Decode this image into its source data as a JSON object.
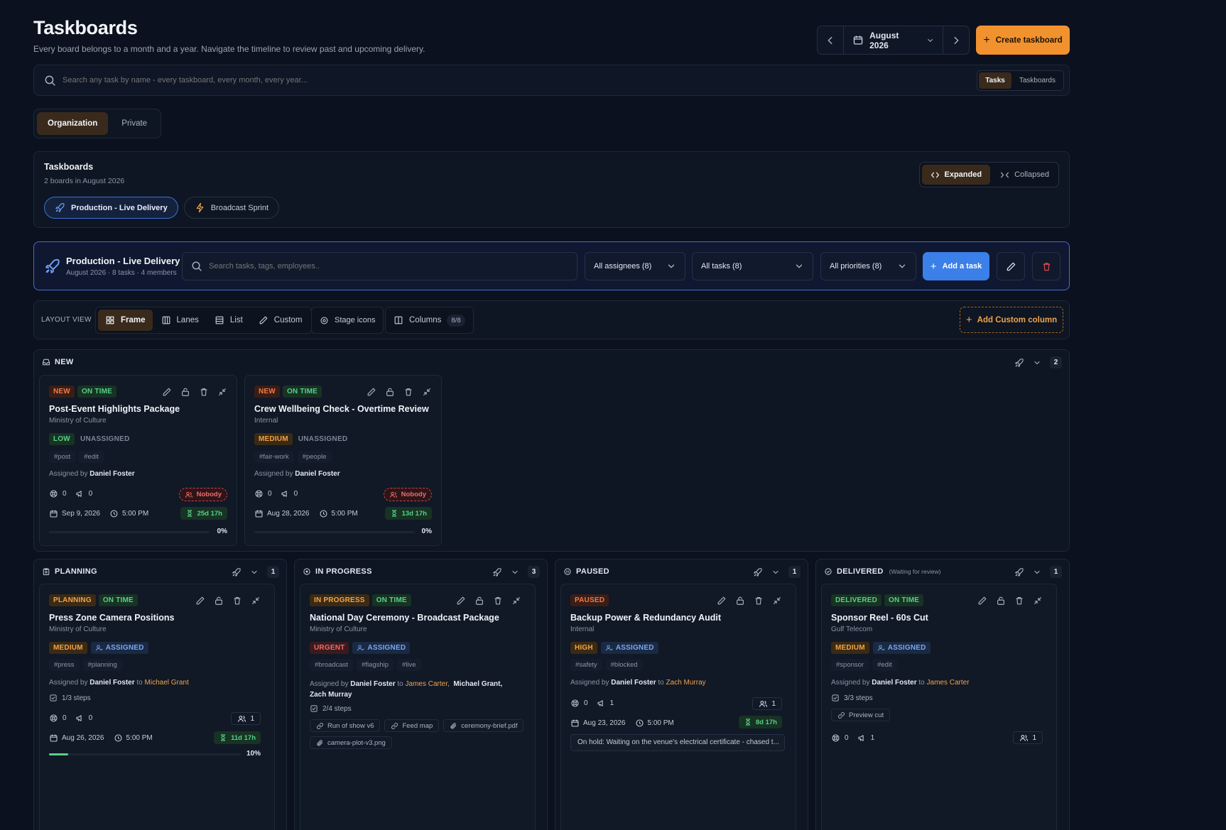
{
  "header": {
    "title": "Taskboards",
    "subtitle": "Every board belongs to a month and a year. Navigate the timeline to review past and upcoming delivery.",
    "month": "August 2026",
    "create_label": "Create taskboard"
  },
  "global_search": {
    "placeholder": "Search any task by name - every taskboard, every month, every year...",
    "tabs": [
      "Tasks",
      "Taskboards"
    ]
  },
  "scope_tabs": [
    "Organization",
    "Private"
  ],
  "boards_panel": {
    "title": "Taskboards",
    "subtitle": "2 boards in August 2026",
    "view_expanded": "Expanded",
    "view_collapsed": "Collapsed",
    "boards": [
      "Production - Live Delivery",
      "Broadcast Sprint"
    ]
  },
  "board": {
    "name": "Production - Live Delivery",
    "meta": "August 2026 · 8 tasks · 4 members",
    "search_placeholder": "Search tasks, tags, employees..",
    "filter_assignees": "All assignees (8)",
    "filter_tasks": "All tasks (8)",
    "filter_priorities": "All priorities (8)",
    "add_task": "Add a task"
  },
  "layout": {
    "label": "LAYOUT VIEW",
    "views": [
      "Frame",
      "Lanes",
      "List",
      "Custom"
    ],
    "stage_icons": "Stage icons",
    "columns": "Columns",
    "columns_count": "8/8",
    "add_column": "Add Custom column"
  },
  "columns": [
    {
      "title": "NEW",
      "count": "2",
      "cards": [
        {
          "stage": "NEW",
          "timing": "ON TIME",
          "title": "Post-Event Highlights Package",
          "client": "Ministry of Culture",
          "priority": "LOW",
          "assign_state": "UNASSIGNED",
          "tags": [
            "#post",
            "#edit"
          ],
          "assigned_by_prefix": "Assigned by",
          "assigned_by": "Daniel Foster",
          "comments": "0",
          "announcements": "0",
          "nobody": "Nobody",
          "date": "Sep 9, 2026",
          "time": "5:00 PM",
          "remaining": "25d 17h",
          "progress": "0%"
        },
        {
          "stage": "NEW",
          "timing": "ON TIME",
          "title": "Crew Wellbeing Check - Overtime Review",
          "client": "Internal",
          "priority": "MEDIUM",
          "assign_state": "UNASSIGNED",
          "tags": [
            "#fair-work",
            "#people"
          ],
          "assigned_by_prefix": "Assigned by",
          "assigned_by": "Daniel Foster",
          "comments": "0",
          "announcements": "0",
          "nobody": "Nobody",
          "date": "Aug 28, 2026",
          "time": "5:00 PM",
          "remaining": "13d 17h",
          "progress": "0%"
        }
      ]
    },
    {
      "title": "PLANNING",
      "count": "1",
      "cards": [
        {
          "stage": "PLANNING",
          "timing": "ON TIME",
          "title": "Press Zone Camera Positions",
          "client": "Ministry of Culture",
          "priority": "MEDIUM",
          "assign_state": "ASSIGNED",
          "tags": [
            "#press",
            "#planning"
          ],
          "assigned_by_prefix": "Assigned by",
          "assigned_by": "Daniel Foster",
          "to": "to",
          "assignees": "Michael Grant",
          "steps": "1/3 steps",
          "comments": "0",
          "announcements": "0",
          "people": "1",
          "date": "Aug 26, 2026",
          "time": "5:00 PM",
          "remaining": "11d 17h",
          "progress": "10%"
        }
      ]
    },
    {
      "title": "IN PROGRESS",
      "count": "3",
      "cards": [
        {
          "stage": "IN PROGRESS",
          "timing": "ON TIME",
          "title": "National Day Ceremony - Broadcast Package",
          "client": "Ministry of Culture",
          "priority": "URGENT",
          "assign_state": "ASSIGNED",
          "tags": [
            "#broadcast",
            "#flagship",
            "#live"
          ],
          "assigned_by_prefix": "Assigned by",
          "assigned_by": "Daniel Foster",
          "to": "to",
          "assignees": "James Carter,",
          "assignees2": "Michael Grant,",
          "assignees3": "Zach Murray",
          "steps": "2/4 steps",
          "attachments": [
            "Run of show v6",
            "Feed map",
            "ceremony-brief.pdf",
            "camera-plot-v3.png"
          ]
        }
      ]
    },
    {
      "title": "PAUSED",
      "count": "1",
      "cards": [
        {
          "stage": "PAUSED",
          "title": "Backup Power & Redundancy Audit",
          "client": "Internal",
          "priority": "HIGH",
          "assign_state": "ASSIGNED",
          "tags": [
            "#safety",
            "#blocked"
          ],
          "assigned_by_prefix": "Assigned by",
          "assigned_by": "Daniel Foster",
          "to": "to",
          "assignees": "Zach Murray",
          "comments": "0",
          "announcements": "1",
          "people": "1",
          "date": "Aug 23, 2026",
          "time": "5:00 PM",
          "remaining": "8d 17h",
          "note": "On hold: Waiting on the venue's electrical certificate - chased t..."
        }
      ]
    },
    {
      "title": "DELIVERED",
      "subtitle": "(Waiting for review)",
      "count": "1",
      "cards": [
        {
          "stage": "DELIVERED",
          "timing": "ON TIME",
          "title": "Sponsor Reel - 60s Cut",
          "client": "Gulf Telecom",
          "priority": "MEDIUM",
          "assign_state": "ASSIGNED",
          "tags": [
            "#sponsor",
            "#edit"
          ],
          "assigned_by_prefix": "Assigned by",
          "assigned_by": "Daniel Foster",
          "to": "to",
          "assignees": "James Carter",
          "steps": "3/3 steps",
          "attachments": [
            "Preview cut"
          ],
          "comments": "0",
          "announcements": "1",
          "people": "1"
        }
      ]
    }
  ]
}
